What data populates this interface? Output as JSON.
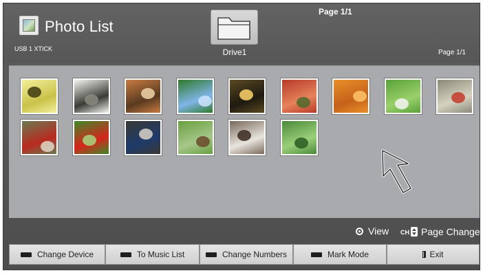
{
  "header": {
    "app_title": "Photo List",
    "device_label": "USB 1 XTICK",
    "drive_label": "Drive1",
    "page_top": "Page 1/1",
    "page_right": "Page 1/1",
    "icons": {
      "app": "photo-app-icon",
      "folder": "folder-icon"
    }
  },
  "thumbnails": [
    {
      "name": "butterfly",
      "colors": [
        "#f2ef9a",
        "#c9c24a",
        "#3d3a10"
      ]
    },
    {
      "name": "horses",
      "colors": [
        "#f5f5f0",
        "#3a3a36",
        "#8a8a80"
      ]
    },
    {
      "name": "wooden-corridor",
      "colors": [
        "#c77c42",
        "#5a3a20",
        "#f0d5a8"
      ]
    },
    {
      "name": "blue-flowers",
      "colors": [
        "#2f7a2a",
        "#7fb4e8",
        "#cfe3ff"
      ]
    },
    {
      "name": "sunset",
      "colors": [
        "#5a4a22",
        "#1f1a10",
        "#ffd36a"
      ]
    },
    {
      "name": "red-maple",
      "colors": [
        "#b83a2a",
        "#e5835a",
        "#4d6a2a"
      ]
    },
    {
      "name": "oranges",
      "colors": [
        "#e8902a",
        "#c5611a",
        "#ffc46a"
      ]
    },
    {
      "name": "dandelion",
      "colors": [
        "#5aa23a",
        "#9ad06a",
        "#f5f5f5"
      ]
    },
    {
      "name": "paint-pots",
      "colors": [
        "#8a8a7a",
        "#d6d2c0",
        "#c23a2a"
      ]
    },
    {
      "name": "red-berries",
      "colors": [
        "#6a7a52",
        "#b92a20",
        "#e0d8c8"
      ]
    },
    {
      "name": "red-tulip",
      "colors": [
        "#3d8a2a",
        "#d6251c",
        "#a6d680"
      ]
    },
    {
      "name": "stone-basin",
      "colors": [
        "#3a3a36",
        "#1e3a6a",
        "#d8d4c8"
      ]
    },
    {
      "name": "garden-path",
      "colors": [
        "#6aa040",
        "#a6c68a",
        "#6a4a2a"
      ]
    },
    {
      "name": "temple-hall",
      "colors": [
        "#7a6a5a",
        "#e8e4de",
        "#3a2a1e"
      ]
    },
    {
      "name": "bamboo",
      "colors": [
        "#4a8a3a",
        "#9ccf7a",
        "#2a5a22"
      ]
    }
  ],
  "hints": {
    "view_label": "View",
    "ch_label": "CH",
    "page_change_label": "Page Change",
    "icons": {
      "view": "ok-circle-icon",
      "channel": "channel-updown-icon"
    }
  },
  "buttons": {
    "change_device": "Change Device",
    "to_music_list": "To Music List",
    "change_numbers": "Change Numbers",
    "mark_mode": "Mark Mode",
    "exit": "Exit",
    "icons": {
      "color_key": "black-key-icon",
      "exit": "exit-door-icon"
    }
  },
  "colors": {
    "background": "#5e5e5e",
    "panel": "#a9aaae",
    "button": "#dcdcdc",
    "text": "#ffffff"
  }
}
